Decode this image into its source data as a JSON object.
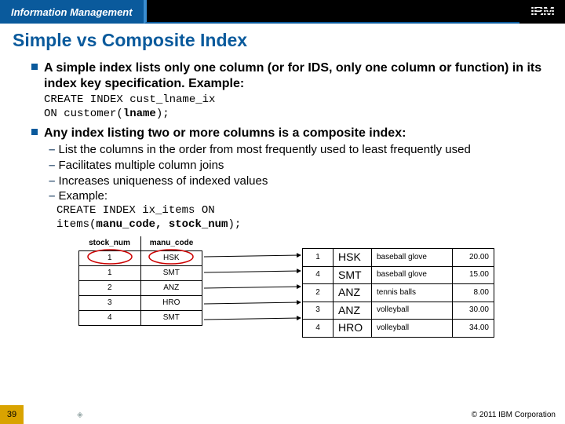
{
  "header": {
    "brand": "Information Management",
    "logo_text": "IBM"
  },
  "title": "Simple vs Composite Index",
  "bullets": {
    "simple": "A simple index lists only one column (or for IDS, only one column or function) in its index key specification. Example:",
    "simple_code_l1": "CREATE INDEX cust_lname_ix",
    "simple_code_l2_pre": "ON customer(",
    "simple_code_l2_bold": "lname",
    "simple_code_l2_post": ");",
    "composite": "Any index listing two or more columns is a composite index:",
    "sub1": "List the columns in the order from most frequently used to least frequently used",
    "sub2": "Facilitates multiple column joins",
    "sub3": "Increases uniqueness of indexed values",
    "sub4": "Example:",
    "comp_code_l1": "CREATE INDEX ix_items ON",
    "comp_code_l2_pre": "items(",
    "comp_code_l2_bold": "manu_code, stock_num",
    "comp_code_l2_post": ");"
  },
  "index_table": {
    "h1": "stock_num",
    "h2": "manu_code",
    "rows": [
      [
        "1",
        "HSK"
      ],
      [
        "1",
        "SMT"
      ],
      [
        "2",
        "ANZ"
      ],
      [
        "3",
        "HRO"
      ],
      [
        "4",
        "SMT"
      ]
    ]
  },
  "data_table": {
    "rows": [
      [
        "1",
        "HSK",
        "baseball glove",
        "20.00"
      ],
      [
        "4",
        "SMT",
        "baseball glove",
        "15.00"
      ],
      [
        "2",
        "ANZ",
        "tennis balls",
        "8.00"
      ],
      [
        "3",
        "ANZ",
        "volleyball",
        "30.00"
      ],
      [
        "4",
        "HRO",
        "volleyball",
        "34.00"
      ]
    ]
  },
  "footer": {
    "page": "39",
    "copyright": "© 2011 IBM Corporation"
  }
}
